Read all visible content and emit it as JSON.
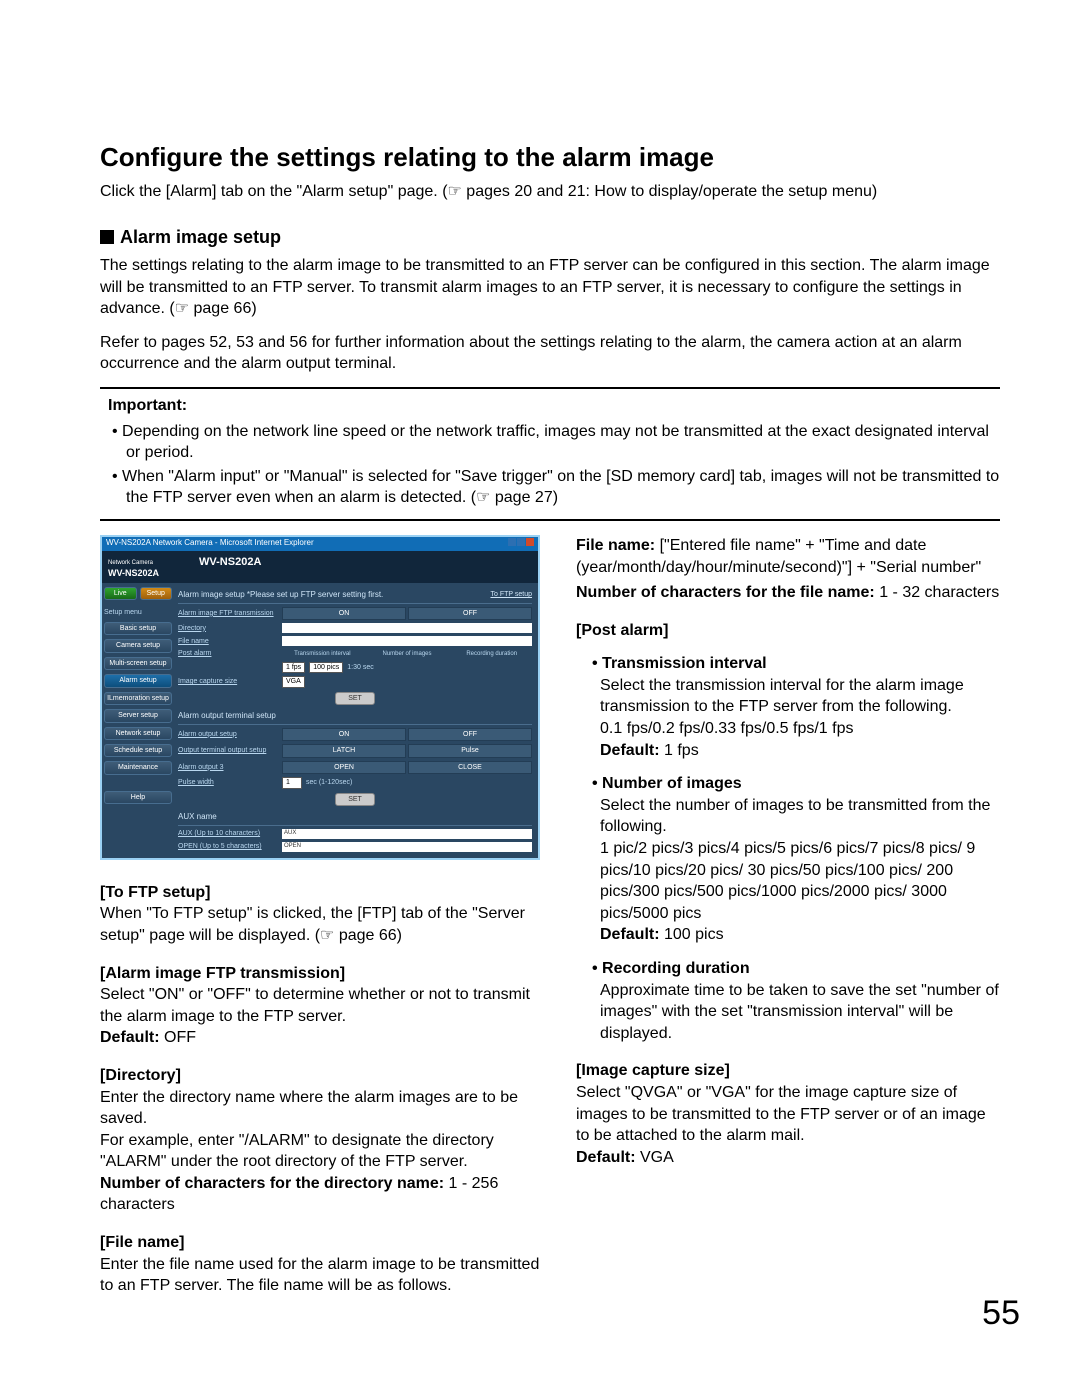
{
  "page": {
    "title": "Configure the settings relating to the alarm image",
    "intro": "Click the [Alarm] tab on the \"Alarm setup\" page. (☞ pages 20 and 21: How to display/operate the setup menu)",
    "h2": "Alarm image setup",
    "body1": "The settings relating to the alarm image to be transmitted to an FTP server can be configured in this section. The alarm image will be transmitted to an FTP server. To transmit alarm images to an FTP server, it is necessary to configure the settings in advance. (☞ page 66)",
    "body2": "Refer to pages 52, 53 and 56 for further information about the settings relating to the alarm, the camera action at an alarm occurrence and the alarm output terminal.",
    "important": {
      "title": "Important:",
      "items": [
        "Depending on the network line speed or the network traffic, images may not be transmitted at the exact designated interval or period.",
        "When \"Alarm input\" or \"Manual\" is selected for \"Save trigger\" on the [SD memory card] tab, images will not be transmitted to the FTP server even when an alarm is detected. (☞ page 27)"
      ]
    },
    "page_number": "55"
  },
  "screenshot": {
    "window_title": "WV-NS202A Network Camera - Microsoft Internet Explorer",
    "cam_label1": "Network Camera",
    "cam_label2": "WV-NS202A",
    "model_header": "WV-NS202A",
    "sidebar": {
      "live": "Live",
      "setup": "Setup",
      "menu_title": "Setup menu",
      "items": [
        "Basic setup",
        "Camera setup",
        "Multi-screen setup",
        "Alarm setup",
        "ILmemoration setup",
        "Server setup",
        "Network setup",
        "Schedule setup",
        "Maintenance"
      ],
      "help": "Help"
    },
    "main": {
      "alarm_image_setup": "Alarm image setup   *Please set up FTP server setting first.",
      "to_ftp": "To FTP setup",
      "rows": {
        "ftp_trans": "Alarm image FTP transmission",
        "on": "ON",
        "off": "OFF",
        "directory": "Directory",
        "file_name": "File name",
        "post_alarm": "Post alarm",
        "ti": "Transmission interval",
        "noi": "Number of images",
        "rd": "Recording duration",
        "ti_val": "1 fps",
        "noi_val": "100 pics",
        "rd_val": "1:30 sec",
        "ics": "Image capture size",
        "ics_val": "VGA"
      },
      "set": "SET",
      "section2": "Alarm output terminal setup",
      "rows2": {
        "aos": "Alarm output setup",
        "on": "ON",
        "off": "OFF",
        "sots": "Output terminal output setup",
        "latch": "LATCH",
        "pulse": "Pulse",
        "ao3": "Alarm output 3",
        "open": "OPEN",
        "close": "CLOSE",
        "pw": "Pulse width",
        "pw_val": "1",
        "sec": "sec (1-120sec)"
      },
      "section3": "AUX name",
      "rows3": {
        "aux": "AUX (Up to 10 characters)",
        "aux_val": "AUX",
        "open": "OPEN (Up to 5 characters)",
        "open_val": "OPEN"
      }
    }
  },
  "left": {
    "toftp_head": "[To FTP setup]",
    "toftp_body": "When \"To FTP setup\" is clicked, the [FTP] tab of the \"Server setup\" page will be displayed. (☞ page 66)",
    "aift_head": "[Alarm image FTP transmission]",
    "aift_body": "Select \"ON\" or \"OFF\" to determine whether or not to transmit the alarm image to the FTP server.",
    "aift_def_label": "Default:",
    "aift_def": " OFF",
    "dir_head": "[Directory]",
    "dir_body1": "Enter the directory name where the alarm images are to be saved.",
    "dir_body2": "For example, enter \"/ALARM\" to designate the directory \"ALARM\" under the root directory of the FTP server.",
    "dir_num_label": "Number of characters for the directory name:",
    "dir_num": " 1 - 256 characters",
    "fn_head": "[File name]",
    "fn_body": "Enter the file name used for the alarm image to be transmitted to an FTP server. The file name will be as follows."
  },
  "right": {
    "fn_label": "File name:",
    "fn_val": " [\"Entered file name\" + \"Time and date (year/month/day/hour/minute/second)\"] + \"Serial number\"",
    "fnchars_label": "Number of characters for the file name:",
    "fnchars_val": " 1 - 32 characters",
    "pa_head": "[Post alarm]",
    "ti_head": "• Transmission interval",
    "ti_body1": "Select the transmission interval for the alarm image transmission to the FTP server from the following.",
    "ti_body2": "0.1 fps/0.2 fps/0.33 fps/0.5 fps/1 fps",
    "ti_def_label": "Default:",
    "ti_def": " 1 fps",
    "noi_head": "• Number of images",
    "noi_body1": "Select the number of images to be transmitted from the following.",
    "noi_body2": "1 pic/2 pics/3 pics/4 pics/5 pics/6 pics/7 pics/8 pics/ 9 pics/10 pics/20 pics/ 30 pics/50 pics/100 pics/ 200 pics/300 pics/500 pics/1000 pics/2000 pics/ 3000 pics/5000 pics",
    "noi_def_label": "Default:",
    "noi_def": " 100 pics",
    "rd_head": "• Recording duration",
    "rd_body": "Approximate time to be taken to save the set \"number of images\" with the set \"transmission interval\" will be displayed.",
    "ics_head": "[Image capture size]",
    "ics_body": "Select \"QVGA\" or \"VGA\" for the image capture size of images to be transmitted to the FTP server or of an image to be attached to the alarm mail.",
    "ics_def_label": "Default:",
    "ics_def": " VGA"
  }
}
